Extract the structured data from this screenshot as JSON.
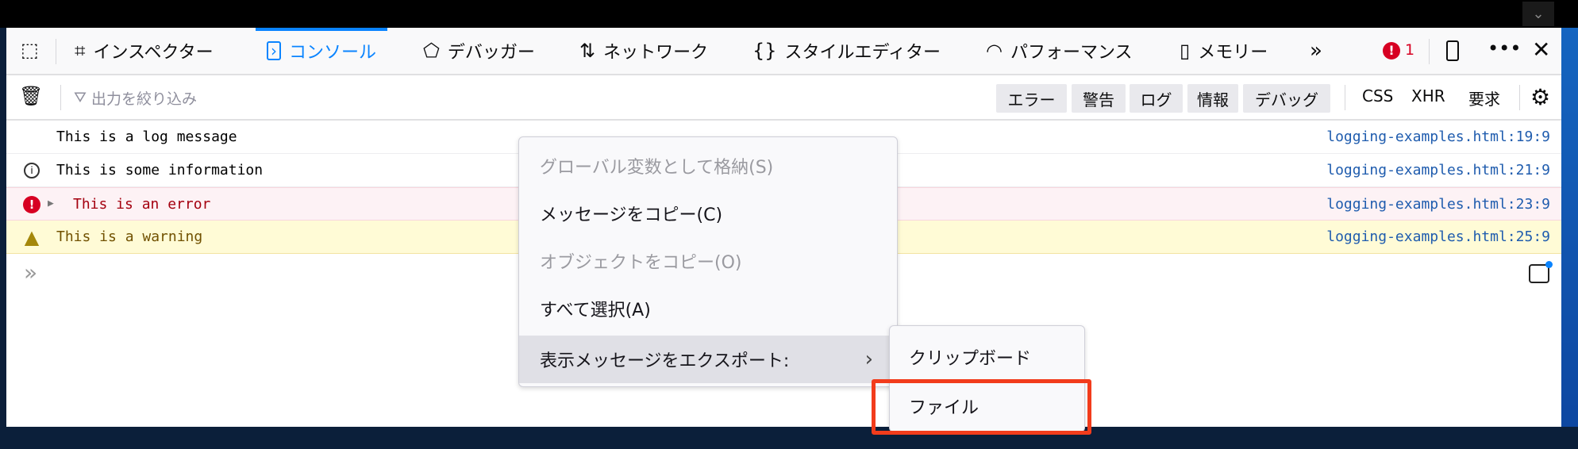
{
  "toolbar": {
    "tabs": [
      {
        "label": "インスペクター",
        "icon": "inspector-icon"
      },
      {
        "label": "コンソール",
        "icon": "console-icon",
        "active": true
      },
      {
        "label": "デバッガー",
        "icon": "debugger-icon"
      },
      {
        "label": "ネットワーク",
        "icon": "network-icon"
      },
      {
        "label": "スタイルエディター",
        "icon": "style-editor-icon"
      },
      {
        "label": "パフォーマンス",
        "icon": "performance-icon"
      },
      {
        "label": "メモリー",
        "icon": "memory-icon"
      }
    ],
    "error_count": "1",
    "accent": "#0a84ff"
  },
  "filterbar": {
    "placeholder": "出力を絞り込み",
    "level_buttons": [
      "エラー",
      "警告",
      "ログ",
      "情報",
      "デバッグ"
    ],
    "type_buttons": [
      "CSS",
      "XHR",
      "要求"
    ]
  },
  "console": {
    "messages": [
      {
        "type": "log",
        "text": "This is a log message",
        "source": "logging-examples.html:19:9"
      },
      {
        "type": "info",
        "text": "This is some information",
        "source": "logging-examples.html:21:9"
      },
      {
        "type": "error",
        "text": "This is an error",
        "source": "logging-examples.html:23:9"
      },
      {
        "type": "warning",
        "text": "This is a warning",
        "source": "logging-examples.html:25:9"
      }
    ]
  },
  "context_menu": {
    "items": [
      {
        "label": "グローバル変数として格納(S)",
        "disabled": true
      },
      {
        "label": "メッセージをコピー(C)",
        "disabled": false
      },
      {
        "label": "オブジェクトをコピー(O)",
        "disabled": true
      },
      {
        "label": "すべて選択(A)",
        "disabled": false
      },
      {
        "label": "表示メッセージをエクスポート:",
        "disabled": false,
        "submenu": true
      }
    ],
    "submenu": [
      "クリップボード",
      "ファイル"
    ],
    "highlight_color": "#f23c1c"
  }
}
